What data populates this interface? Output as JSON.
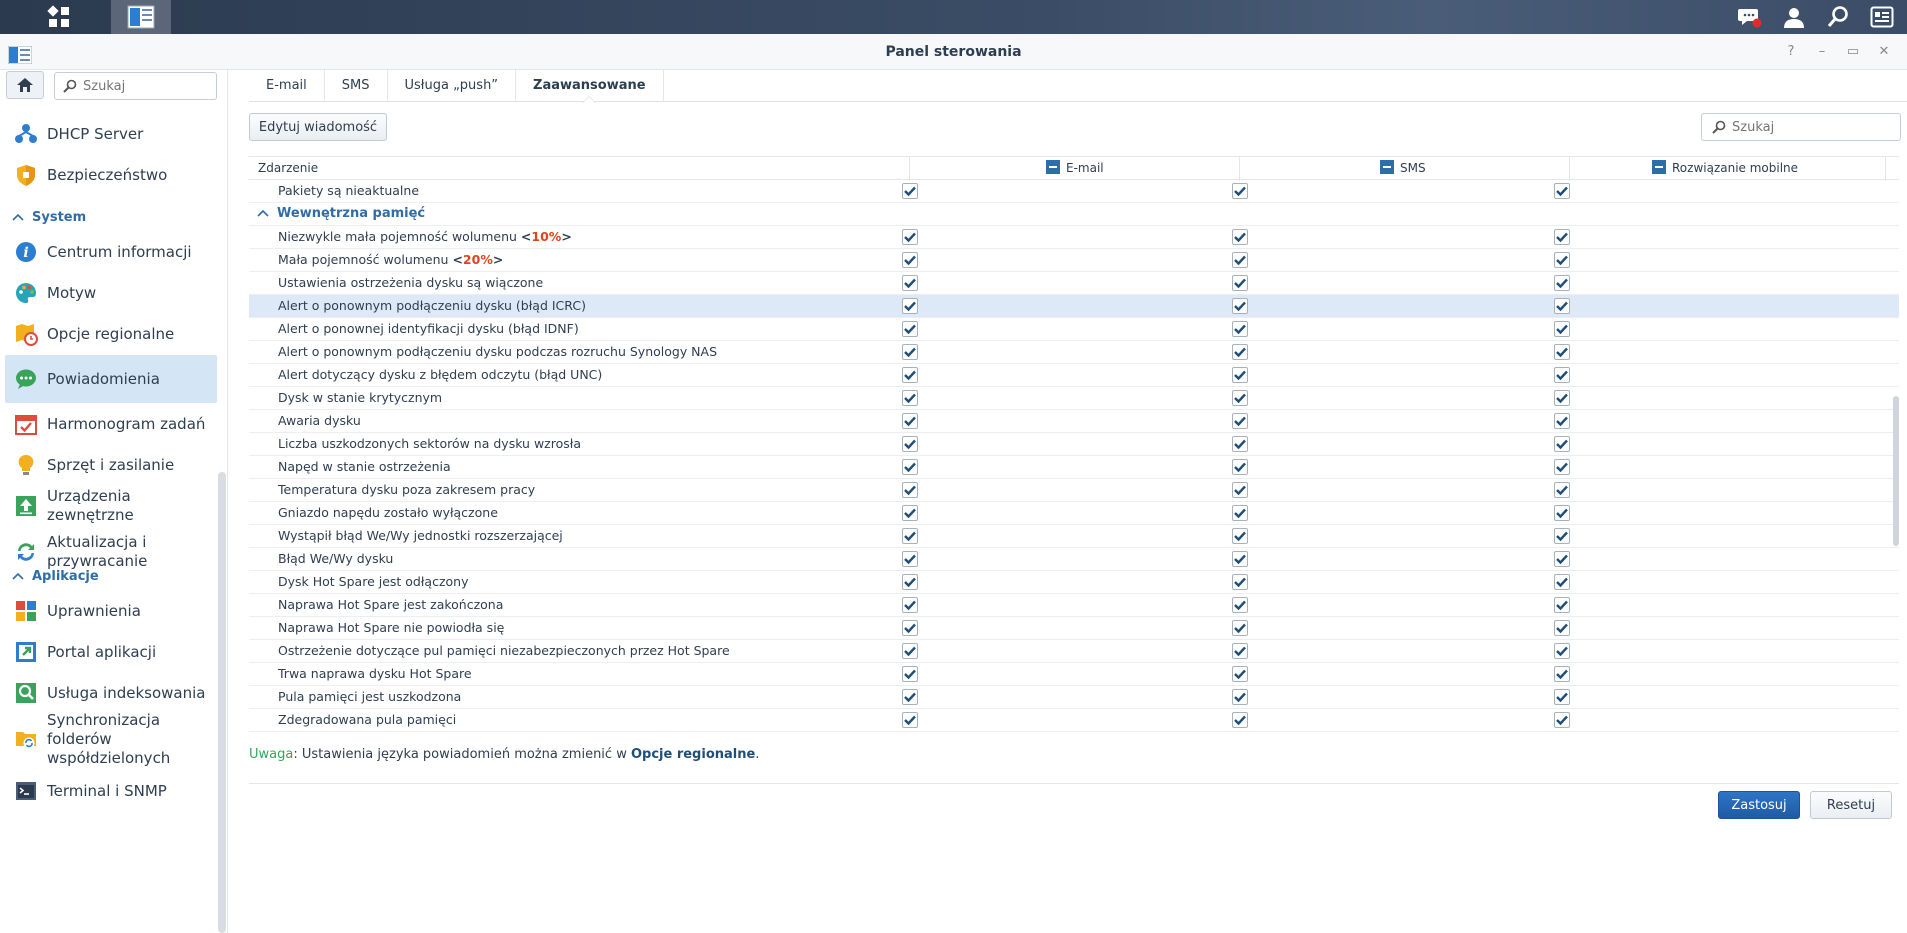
{
  "taskbar": {
    "main_menu_icon": "grid-icon",
    "app_icon": "control-panel-icon",
    "notifications_icon": "chat-icon",
    "user_icon": "user-icon",
    "search_icon": "search-icon",
    "widgets_icon": "widgets-icon"
  },
  "window": {
    "title": "Panel sterowania",
    "controls": [
      "?",
      "–",
      "▭",
      "✕"
    ]
  },
  "sidebar": {
    "search_placeholder": "Szukaj",
    "items": [
      {
        "label": "DHCP Server",
        "icon": "dhcp-icon"
      },
      {
        "label": "Bezpieczeństwo",
        "icon": "shield-icon"
      },
      {
        "label": "Centrum informacji",
        "icon": "info-icon"
      },
      {
        "label": "Motyw",
        "icon": "palette-icon"
      },
      {
        "label": "Opcje regionalne",
        "icon": "regional-icon"
      },
      {
        "label": "Powiadomienia",
        "icon": "notifications-icon"
      },
      {
        "label": "Harmonogram zadań",
        "icon": "calendar-icon"
      },
      {
        "label": "Sprzęt i zasilanie",
        "icon": "bulb-icon"
      },
      {
        "label": "Urządzenia zewnętrzne",
        "icon": "external-device-icon"
      },
      {
        "label": "Aktualizacja i przywracanie",
        "icon": "update-icon"
      },
      {
        "label": "Uprawnienia",
        "icon": "permissions-icon"
      },
      {
        "label": "Portal aplikacji",
        "icon": "app-portal-icon"
      },
      {
        "label": "Usługa indeksowania",
        "icon": "index-icon"
      },
      {
        "label": "Synchronizacja folderów współdzielonych",
        "icon": "folder-sync-icon"
      },
      {
        "label": "Terminal i SNMP",
        "icon": "terminal-icon"
      }
    ],
    "sections": {
      "system": "System",
      "apps": "Aplikacje"
    }
  },
  "tabs": [
    "E-mail",
    "SMS",
    "Usługa „push”",
    "Zaawansowane"
  ],
  "toolbar": {
    "edit_label": "Edytuj wiadomość",
    "search_placeholder": "Szukaj"
  },
  "grid": {
    "headers": {
      "event": "Zdarzenie",
      "email": "E-mail",
      "sms": "SMS",
      "mobile": "Rozwiązanie mobilne"
    },
    "top_row": "Pakiety są nieaktualne",
    "group": "Wewnętrzna pamięć",
    "low_vol_1_prefix": "Niezwykle mała pojemność wolumenu ",
    "low_vol_1_lt": "<",
    "low_vol_1_pct": "10%",
    "low_vol_1_gt": ">",
    "low_vol_2_prefix": "Mała pojemność wolumenu ",
    "low_vol_2_lt": "<",
    "low_vol_2_pct": "20%",
    "low_vol_2_gt": ">",
    "rows": [
      "Ustawienia ostrzeżenia dysku są wiączone",
      "Alert o ponownym podłączeniu dysku (błąd ICRC)",
      "Alert o ponownej identyfikacji dysku (błąd IDNF)",
      "Alert o ponownym podłączeniu dysku podczas rozruchu Synology NAS",
      "Alert dotyczący dysku z błędem odczytu (błąd UNC)",
      "Dysk w stanie krytycznym",
      "Awaria dysku",
      "Liczba uszkodzonych sektorów na dysku wzrosła",
      "Napęd w stanie ostrzeżenia",
      "Temperatura dysku poza zakresem pracy",
      "Gniazdo napędu zostało wyłączone",
      "Wystąpił błąd We/Wy jednostki rozszerzającej",
      "Błąd We/Wy dysku",
      "Dysk Hot Spare jest odłączony",
      "Naprawa Hot Spare jest zakończona",
      "Naprawa Hot Spare nie powiodła się",
      "Ostrzeżenie dotyczące pul pamięci niezabezpieczonych przez Hot Spare",
      "Trwa naprawa dysku Hot Spare",
      "Pula pamięci jest uszkodzona",
      "Zdegradowana pula pamięci"
    ],
    "selected_row_index": 1
  },
  "note": {
    "label": "Uwaga",
    "text": ": Ustawienia języka powiadomień można zmienić w ",
    "link": "Opcje regionalne",
    "end": "."
  },
  "footer": {
    "apply": "Zastosuj",
    "reset": "Resetuj"
  },
  "colors": {
    "accent": "#2e6da8",
    "selected_row": "#dde9f7",
    "active_sidebar": "#d4e5f6",
    "highlight": "#e0441c"
  }
}
